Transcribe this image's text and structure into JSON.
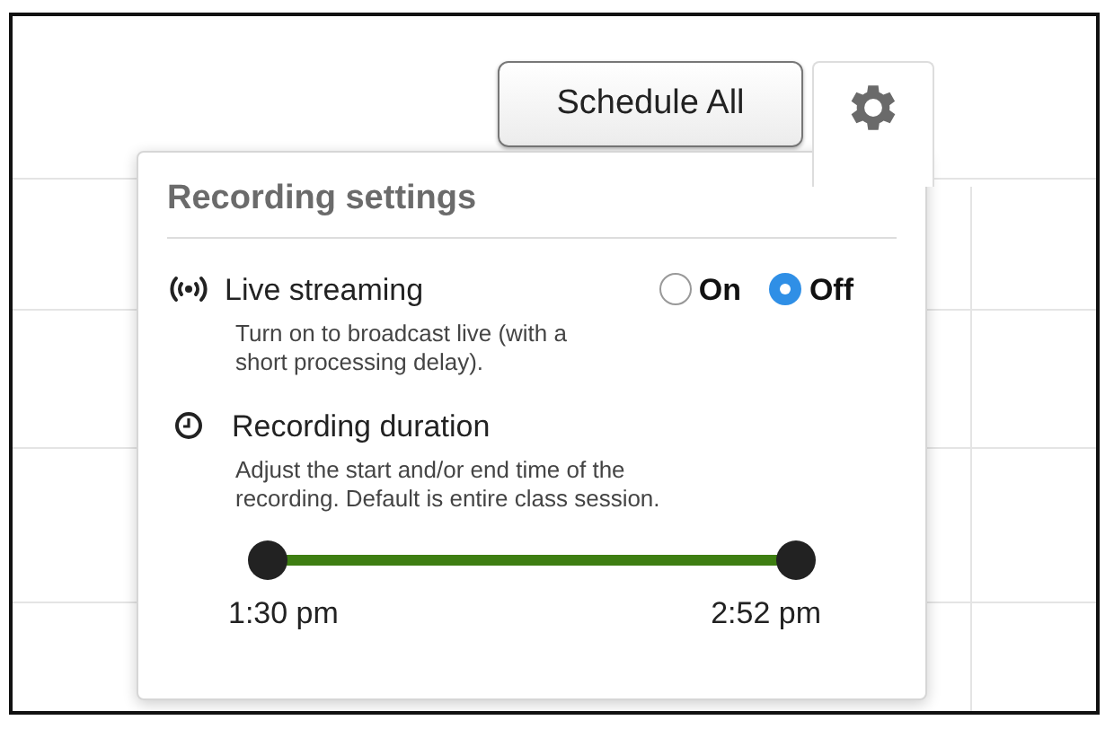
{
  "toolbar": {
    "schedule_button": "Schedule All"
  },
  "popover": {
    "title": "Recording settings",
    "live_streaming": {
      "label": "Live streaming",
      "description": "Turn on to broadcast live (with a short processing delay).",
      "options": [
        {
          "label": "On",
          "selected": false
        },
        {
          "label": "Off",
          "selected": true
        }
      ]
    },
    "recording_duration": {
      "label": "Recording duration",
      "description": "Adjust the start and/or end time of the recording. Default is entire class session.",
      "slider": {
        "thumbs": [
          {
            "level": 0,
            "reading": "1:30 pm"
          },
          {
            "level": 1,
            "reading": "2:52 pm"
          }
        ]
      }
    }
  }
}
